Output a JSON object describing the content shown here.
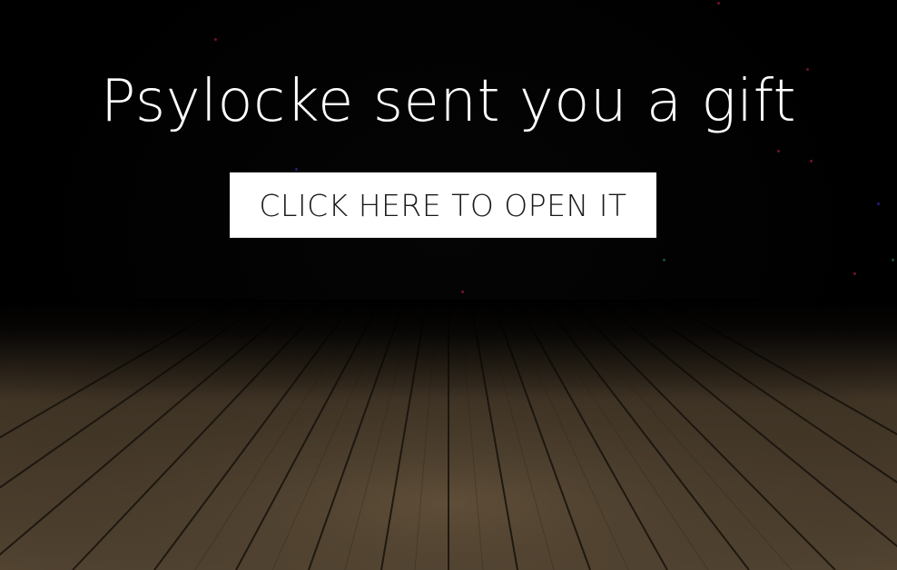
{
  "page": {
    "title": "Psylocke sent you a gift",
    "open_button_label": "CLICK HERE TO OPEN IT"
  },
  "colors": {
    "background": "#000000",
    "title_text": "#ffffff",
    "button_background": "#ffffff",
    "button_text": "#1a1a1a",
    "floor_wood": "#4a3d2c",
    "sparkle_red": "#c8204a",
    "sparkle_blue": "#3a3ad0",
    "sparkle_teal": "#1f8f7a"
  }
}
